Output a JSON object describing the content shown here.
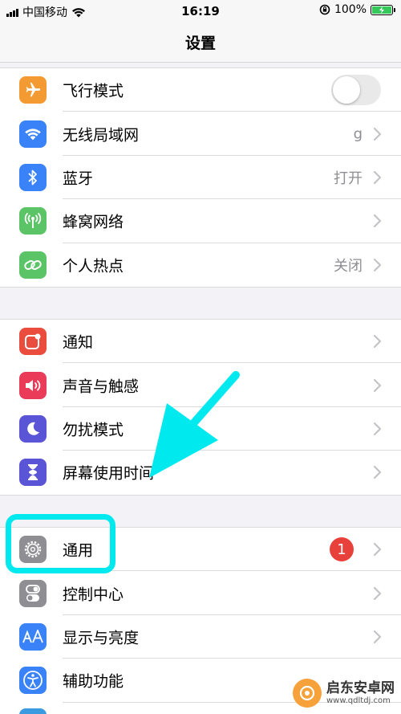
{
  "status_bar": {
    "carrier": "中国移动",
    "time": "16:19",
    "battery_percent": "100%"
  },
  "nav": {
    "title": "设置"
  },
  "groups": [
    {
      "items": [
        {
          "label": "飞行模式",
          "icon": "airplane-icon",
          "color": "#f49a33",
          "control": "toggle",
          "toggle_on": false
        },
        {
          "label": "无线局域网",
          "icon": "wifi-icon",
          "color": "#3a82f7",
          "value": "g"
        },
        {
          "label": "蓝牙",
          "icon": "bluetooth-icon",
          "color": "#3a82f7",
          "value": "打开"
        },
        {
          "label": "蜂窝网络",
          "icon": "antenna-icon",
          "color": "#5bc466",
          "value": ""
        },
        {
          "label": "个人热点",
          "icon": "hotspot-icon",
          "color": "#5bc466",
          "value": "关闭"
        }
      ]
    },
    {
      "items": [
        {
          "label": "通知",
          "icon": "notification-icon",
          "color": "#ea4c3d"
        },
        {
          "label": "声音与触感",
          "icon": "speaker-icon",
          "color": "#ea3c58"
        },
        {
          "label": "勿扰模式",
          "icon": "moon-icon",
          "color": "#5a54d6"
        },
        {
          "label": "屏幕使用时间",
          "icon": "hourglass-icon",
          "color": "#5a54d6"
        }
      ]
    },
    {
      "items": [
        {
          "label": "通用",
          "icon": "gear-icon",
          "color": "#8e8e93",
          "badge": "1"
        },
        {
          "label": "控制中心",
          "icon": "switches-icon",
          "color": "#8e8e93"
        },
        {
          "label": "显示与亮度",
          "icon": "text-size-icon",
          "color": "#3a82f7"
        },
        {
          "label": "辅助功能",
          "icon": "accessibility-icon",
          "color": "#3a82f7"
        }
      ]
    }
  ],
  "annotation": {
    "highlight_color": "#00e9ee"
  },
  "watermark": {
    "name": "启东安卓网",
    "url": "www.qdltdj.com"
  }
}
